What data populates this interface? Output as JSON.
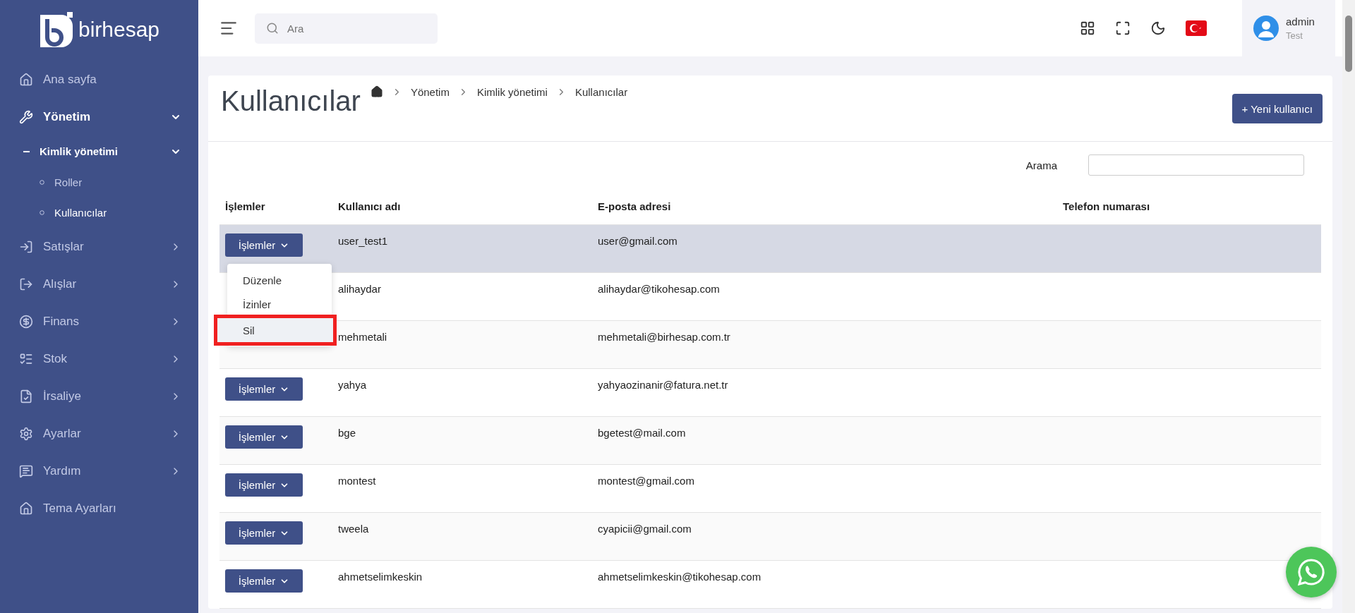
{
  "sidebar": {
    "logo": "birhesap",
    "items": [
      {
        "label": "Ana sayfa",
        "kind": "link",
        "expanded": false
      },
      {
        "label": "Yönetim",
        "kind": "group",
        "expanded": true,
        "children": [
          {
            "label": "Kimlik yönetimi",
            "kind": "group",
            "expanded": true,
            "children": [
              {
                "label": "Roller",
                "selected": false
              },
              {
                "label": "Kullanıcılar",
                "selected": true
              }
            ]
          }
        ]
      },
      {
        "label": "Satışlar",
        "kind": "group",
        "expanded": false
      },
      {
        "label": "Alışlar",
        "kind": "group",
        "expanded": false
      },
      {
        "label": "Finans",
        "kind": "group",
        "expanded": false
      },
      {
        "label": "Stok",
        "kind": "group",
        "expanded": false
      },
      {
        "label": "İrsaliye",
        "kind": "group",
        "expanded": false
      },
      {
        "label": "Ayarlar",
        "kind": "group",
        "expanded": false
      },
      {
        "label": "Yardım",
        "kind": "group",
        "expanded": false
      },
      {
        "label": "Tema Ayarları",
        "kind": "link",
        "expanded": false
      }
    ]
  },
  "header": {
    "search": {
      "placeholder": "Ara"
    },
    "user": {
      "name": "admin",
      "role": "Test"
    }
  },
  "page": {
    "title": "Kullanıcılar",
    "breadcrumb": [
      "Yönetim",
      "Kimlik yönetimi",
      "Kullanıcılar"
    ],
    "new_button": "+ Yeni kullanıcı",
    "search_label": "Arama"
  },
  "table": {
    "columns": [
      "İşlemler",
      "Kullanıcı adı",
      "E-posta adresi",
      "Telefon numarası"
    ],
    "rows": [
      {
        "action": "İşlemler",
        "username": "user_test1",
        "email": "user@gmail.com",
        "selected": true,
        "menu": [
          {
            "label": "Düzenle",
            "highlighted": false
          },
          {
            "label": "İzinler",
            "highlighted": false
          },
          {
            "label": "Sil",
            "highlighted": true
          }
        ]
      },
      {
        "username": "alihaydar",
        "email": "alihaydar@tikohesap.com",
        "selected": false
      },
      {
        "username": "mehmetali",
        "email": "mehmetali@birhesap.com.tr",
        "selected": false
      },
      {
        "action": "İşlemler",
        "username": "yahya",
        "email": "yahyaozinanir@fatura.net.tr",
        "selected": false
      },
      {
        "action": "İşlemler",
        "username": "bge",
        "email": "bgetest@mail.com",
        "selected": false
      },
      {
        "action": "İşlemler",
        "username": "montest",
        "email": "montest@gmail.com",
        "selected": false
      },
      {
        "action": "İşlemler",
        "username": "tweela",
        "email": "cyapicii@gmail.com",
        "selected": false
      },
      {
        "action": "İşlemler",
        "username": "ahmetselimkeskin",
        "email": "ahmetselimkeskin@tikohesap.com",
        "selected": false
      }
    ]
  }
}
